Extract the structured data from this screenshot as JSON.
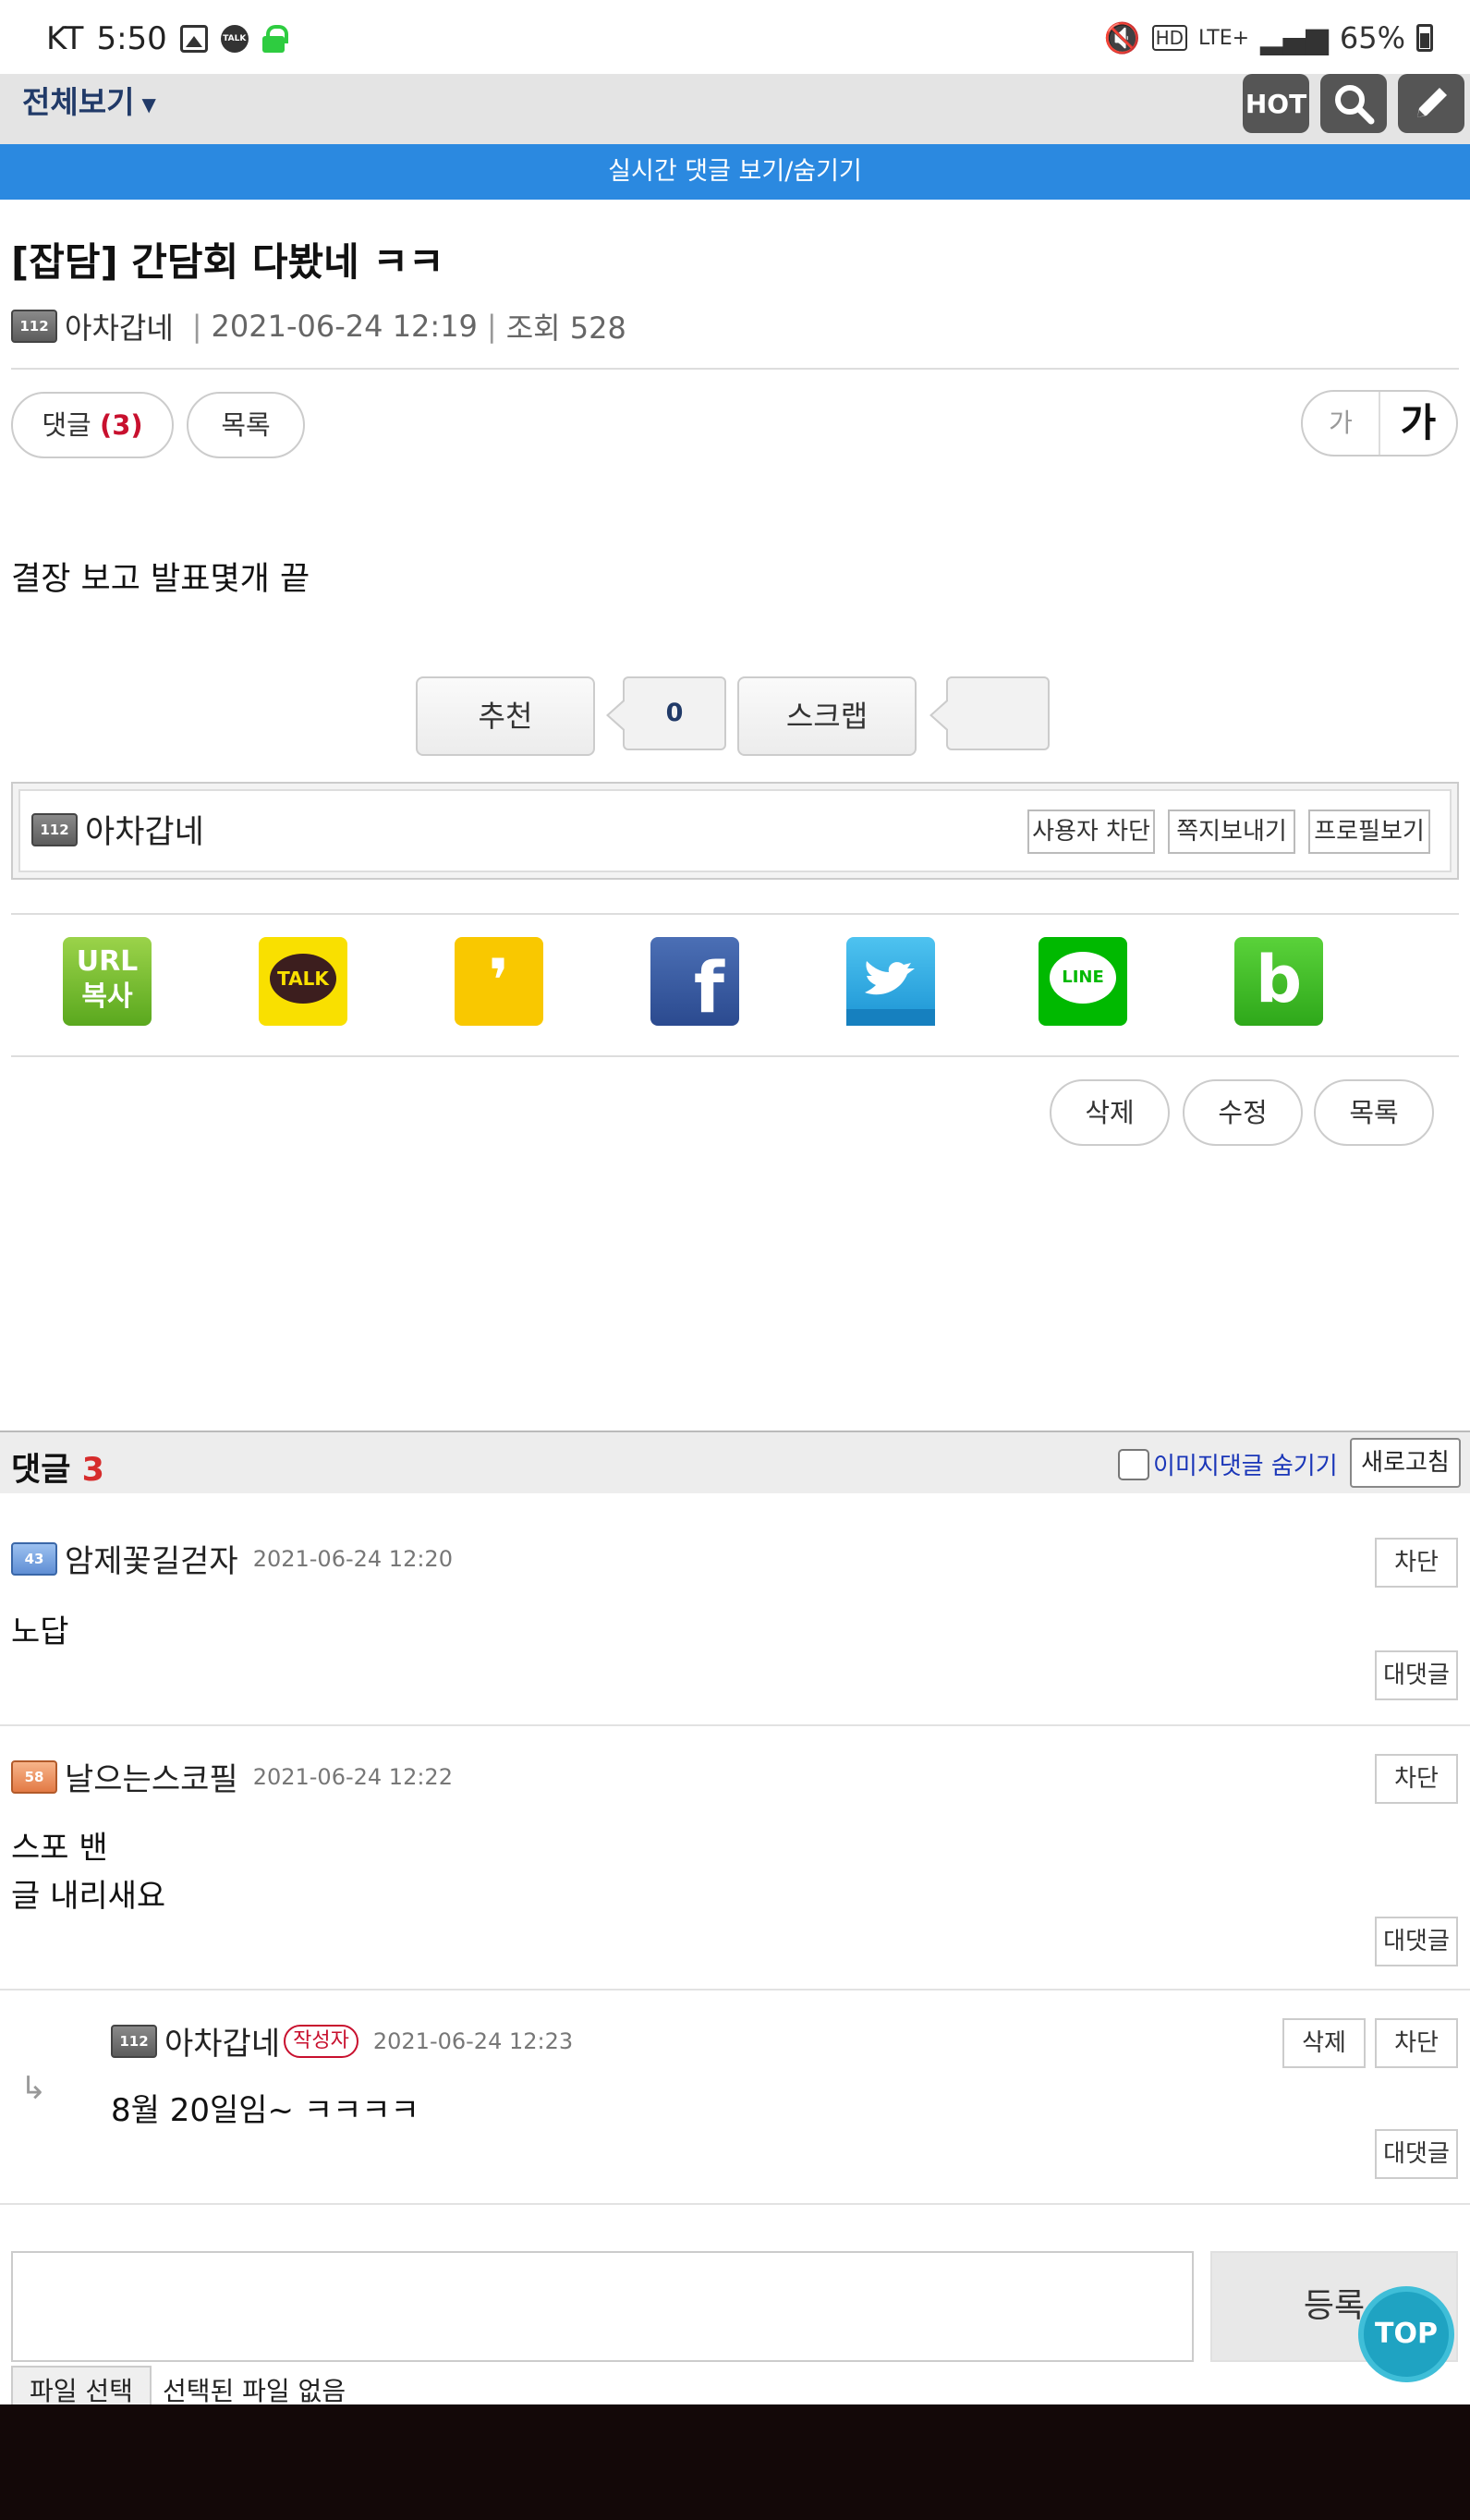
{
  "status_bar": {
    "carrier": "KT",
    "time": "5:50",
    "network": "LTE+",
    "battery": "65%"
  },
  "top_nav": {
    "view_all": "전체보기",
    "hot_label": "HOT"
  },
  "realtime_bar": "실시간 댓글 보기/숨기기",
  "post": {
    "title": "[잡담] 간담회 다봤네 ㅋㅋ",
    "author": "아차갑네",
    "author_level": "112",
    "date": "2021-06-24 12:19",
    "views": "조회 528",
    "body": "결장 보고 발표몇개 끝"
  },
  "action_pills": {
    "comment_label": "댓글",
    "comment_count": "(3)",
    "list_label": "목록",
    "font_small": "가",
    "font_large": "가"
  },
  "vote": {
    "recommend_label": "추천",
    "recommend_count": "0",
    "scrap_label": "스크랩",
    "scrap_count": ""
  },
  "author_box": {
    "name": "아차갑네",
    "block_label": "사용자 차단",
    "message_label": "쪽지보내기",
    "profile_label": "프로필보기"
  },
  "share": {
    "url_copy_line1": "URL",
    "url_copy_line2": "복사",
    "kakaotalk": "TALK",
    "kakaostory": "❜",
    "facebook": "f",
    "line": "LINE",
    "band": "b"
  },
  "post_actions": {
    "delete": "삭제",
    "edit": "수정",
    "list": "목록"
  },
  "comments_header": {
    "label": "댓글",
    "count": "3",
    "hide_image_comments": "이미지댓글 숨기기",
    "refresh": "새로고침"
  },
  "comments": [
    {
      "author": "암제꽃길걷자",
      "level": "43",
      "date": "2021-06-24 12:20",
      "text": "노답",
      "block": "차단",
      "reply": "대댓글"
    },
    {
      "author": "날으는스코필",
      "level": "58",
      "date": "2021-06-24 12:22",
      "text_line1": "스포 밴",
      "text_line2": "글 내리새요",
      "block": "차단",
      "reply": "대댓글"
    },
    {
      "author": "아차갑네",
      "level": "112",
      "badge": "작성자",
      "date": "2021-06-24 12:23",
      "text": "8월 20일임~ ㅋㅋㅋㅋ",
      "delete": "삭제",
      "block": "차단",
      "reply": "대댓글"
    }
  ],
  "write": {
    "submit": "등록",
    "file_button": "파일 선택",
    "file_status": "선택된 파일 없음",
    "top_button": "TOP"
  },
  "colors": {
    "accent_blue": "#2b89e0",
    "nav_text": "#213a68",
    "comment_count_red": "#d62c2c"
  }
}
